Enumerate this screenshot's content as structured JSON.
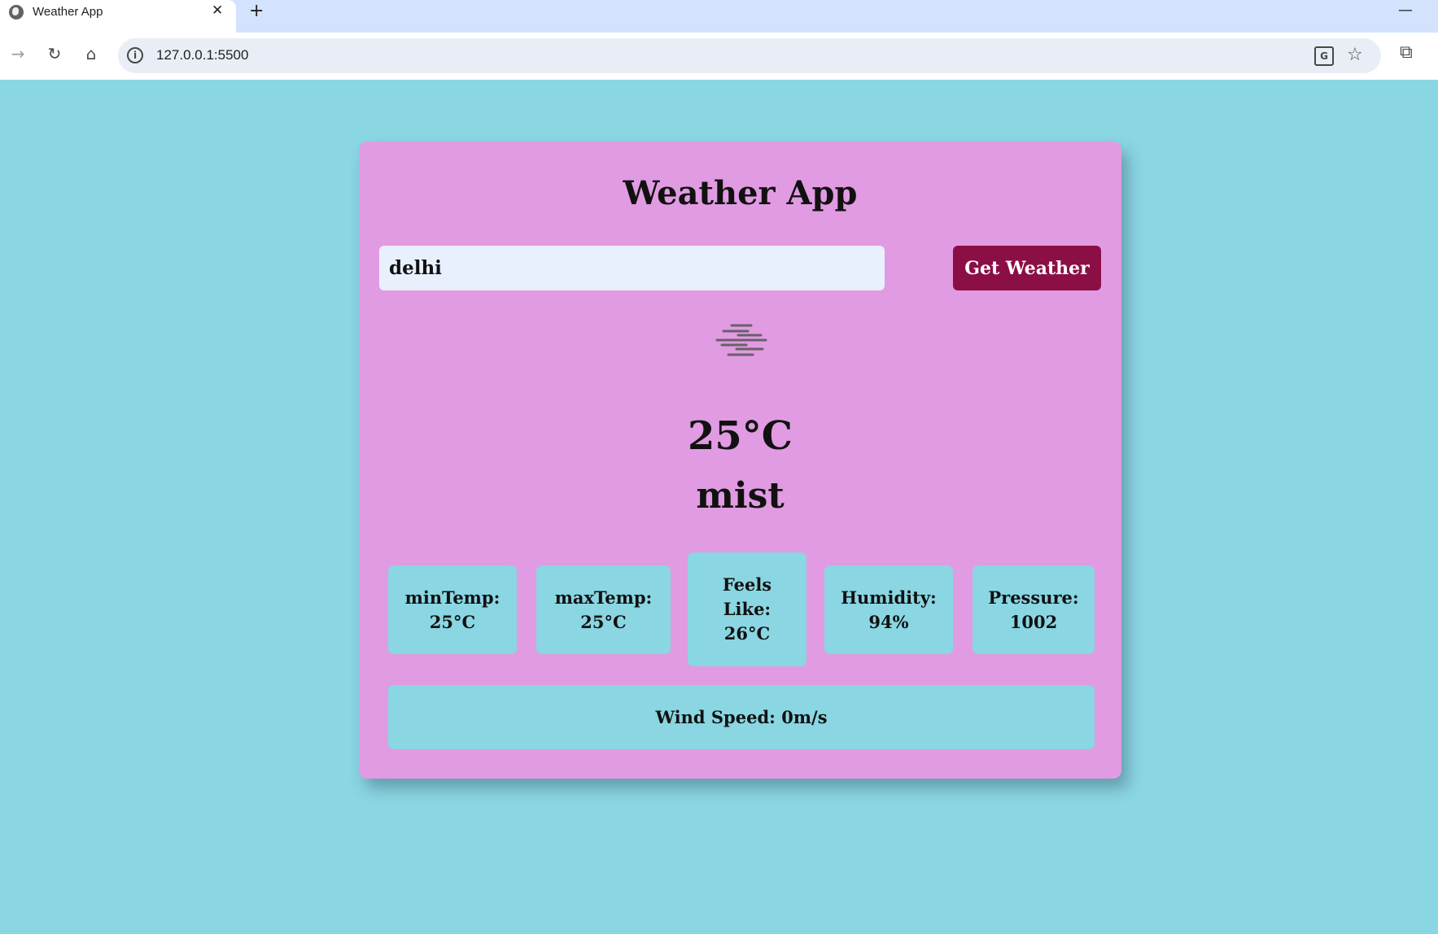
{
  "browser": {
    "tab_title": "Weather App",
    "tab_close": "✕",
    "new_tab": "+",
    "minimize": "—",
    "url": "127.0.0.1:5500",
    "icons": {
      "forward": "→",
      "reload": "↻",
      "home": "⌂",
      "info": "i",
      "translate": "G",
      "star": "☆",
      "extensions": "⧉"
    }
  },
  "app": {
    "title": "Weather App",
    "search": {
      "value": "delhi",
      "button_label": "Get Weather"
    },
    "weather_icon": "mist-icon",
    "temperature": "25°C",
    "description": "mist",
    "stats": {
      "min_temp": "minTemp:\n25°C",
      "max_temp": "maxTemp:\n25°C",
      "feels_like": "Feels\nLike:\n26°C",
      "humidity": "Humidity:\n94%",
      "pressure": "Pressure:\n1002"
    },
    "wind_speed": "Wind Speed: 0m/s"
  },
  "colors": {
    "page_background": "#8ad6e3",
    "card_background": "#e19be2",
    "button_background": "#8b0f45",
    "stat_background": "#8ad6e3",
    "input_background": "#e8f0fe"
  }
}
